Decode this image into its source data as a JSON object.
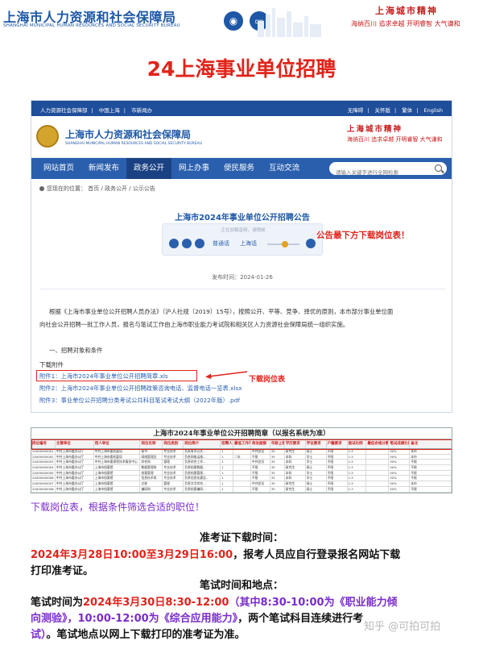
{
  "banner": {
    "bureau_name": "上海市人力资源和社会保障局",
    "bureau_name_en": "SHANGHAI MUNICIPAL HUMAN RESOURCES AND SOCIAL SECURITY BUREAU",
    "spirit_title": "上海城市精神",
    "spirit_words": "海纳百川  追求卓越  开明睿智  大气谦和",
    "icons": [
      "weibo-icon",
      "monitor-icon"
    ]
  },
  "main_title": "24上海事业单位招聘",
  "site": {
    "topbar_left": [
      "人力资源社会保障部",
      "中国上海",
      "市新闻办"
    ],
    "topbar_right": [
      "无障碍",
      "关怀版",
      "繁体",
      "English"
    ],
    "site_name": "上海市人力资源和社会保障局",
    "site_name_en": "SHANGHAI MUNICIPAL HUMAN RESOURCES AND SOCIAL SECURITY BUREAU",
    "site_spirit": "上海城市精神",
    "site_spirit_words": "海纳百川  追求卓越  开明睿智  大气谦和",
    "nav": [
      "网站首页",
      "新闻发布",
      "政务公开",
      "网上办事",
      "便民服务",
      "互动交流"
    ],
    "active_nav": "政务公开",
    "search_placeholder": "请输入关键字进行全网检索",
    "breadcrumb": "您现在的位置：  首页 / 政务公开 / 公示公告",
    "notice_title": "上海市2024年事业单位公开招聘公告",
    "player_hint": "正在加载音频，请稍候",
    "player_tags": [
      "普通话",
      "上海话"
    ],
    "red_note": "公告最下方下载岗位表！",
    "pub_date": "发布时间：2024-01-26",
    "paragraph": [
      "根据《上海市事业单位公开招聘人员办法》（沪人社规〔2019〕15号），按照公开、平等、竞争、择优的原则，本市部分事业单位面",
      "向社会公开招聘一批工作人员，报名与笔试工作由上海市职业能力考试院和相关区人力资源社会保障局统一组织实施。"
    ],
    "section_heading": "一、招聘对象和条件",
    "attachments_heading": "下载附件",
    "attachments": [
      "附件1：上海市2024年事业单位公开招聘简章.xls",
      "附件2：上海市2024年事业单位公开招聘政策咨询电话、监督电话一览表.xlsx",
      "附件3：事业单位公开招聘分类考试公共科目笔试考试大纲（2022年版）.pdf"
    ],
    "red_note2": "下载岗位表"
  },
  "sheet": {
    "title": "上海市2024年事业单位公开招聘简章（以报名系统为准）",
    "headers": [
      "岗位编号",
      "主管单位",
      "用人单位",
      "岗位名称",
      "岗位类别",
      "岗位简介",
      "招聘人数",
      "最低工作年限",
      "政治面貌",
      "年龄上限",
      "学历要求",
      "学位要求",
      "户籍要求",
      "面试比例",
      "最低合格分数线",
      "笔试成绩比例",
      "备注"
    ],
    "rows": [
      [
        "24000000001",
        "中共上海市委办公厅",
        "中共上海市委机要局",
        "秘书",
        "专业技术",
        "负责有关公文...",
        "1",
        "",
        "中共党员",
        "35",
        "研究生",
        "硕士",
        "不限",
        "1:3",
        "",
        "50%",
        "本市"
      ],
      [
        "24000000002",
        "中共上海市委办公厅",
        "中共上海市委机要局",
        "网络管理员",
        "专业技术",
        "负责网络运维...",
        "1",
        "二年",
        "不限",
        "35",
        "本科",
        "学士",
        "不限",
        "1:3",
        "",
        "50%",
        "本市"
      ],
      [
        "24000000003",
        "中共上海市委办公厅",
        "中共上海市委保密技术服务中心",
        "综合岗",
        "管理",
        "负责综合工作...",
        "1",
        "",
        "中共党员",
        "35",
        "本科",
        "学士",
        "不限",
        "1:3",
        "",
        "50%",
        "不限"
      ],
      [
        "24000000004",
        "中共上海市委办公厅",
        "上海市档案馆",
        "数据管理岗",
        "专业技术",
        "负责档案数据...",
        "1",
        "",
        "不限",
        "35",
        "研究生",
        "硕士",
        "不限",
        "1:3",
        "",
        "50%",
        "不限"
      ],
      [
        "24000000005",
        "中共上海市委办公厅",
        "上海市档案馆",
        "档案管理",
        "专业技术",
        "负责档案管理...",
        "1",
        "",
        "不限",
        "35",
        "本科",
        "学士",
        "不限",
        "1:3",
        "",
        "50%",
        "不限"
      ],
      [
        "24000000006",
        "中共上海市委办公厅",
        "上海市档案馆",
        "信息技术岗",
        "专业技术",
        "负责信息化建设...",
        "1",
        "",
        "不限",
        "35",
        "本科",
        "学士",
        "不限",
        "1:3",
        "",
        "50%",
        "不限"
      ],
      [
        "24000000007",
        "中共上海市委办公厅",
        "上海市档案馆",
        "文秘",
        "管理",
        "负责文字综合...",
        "1",
        "",
        "中共党员",
        "35",
        "研究生",
        "硕士",
        "不限",
        "1:3",
        "",
        "50%",
        "本市"
      ],
      [
        "24000000008",
        "中共上海市委办公厅",
        "上海市档案馆",
        "编研岗",
        "专业技术",
        "负责档案编研...",
        "1",
        "",
        "不限",
        "35",
        "研究生",
        "硕士",
        "不限",
        "1:3",
        "",
        "50%",
        "不限"
      ],
      [
        "24000000009",
        "中共上海市委办公厅",
        "上海市档案馆",
        "技术保护",
        "专业技术",
        "负责档案保护...",
        "1",
        "",
        "不限",
        "35",
        "本科",
        "学士",
        "不限",
        "1:3",
        "",
        "50%",
        "不限"
      ]
    ]
  },
  "purple_note": "下载岗位表，根据条件筛选合适的职位！",
  "admission": {
    "title": "准考证下载时间：",
    "line1_red": "2024年3月28日10:00至3月29日16:00",
    "line1_rest": "，报考人员应自行登录报名网站下载",
    "line2": "打印准考证。"
  },
  "exam": {
    "title": "笔试时间和地点：",
    "line1_a": "笔试时间为",
    "line1_red": "2024年3月30日8:30-12:00",
    "line1_purple": "（其中8:30-10:00为《职业能力倾",
    "line2_purple": "向测验》，10:00-12:00为《综合应用能力》",
    "line2_rest": "，两个笔试科目连续进行考",
    "line3_purple": "试）",
    "line3_rest": "。笔试地点以网上下载打印的准考证为准。"
  },
  "watermark": "知乎 @可拍可拍"
}
